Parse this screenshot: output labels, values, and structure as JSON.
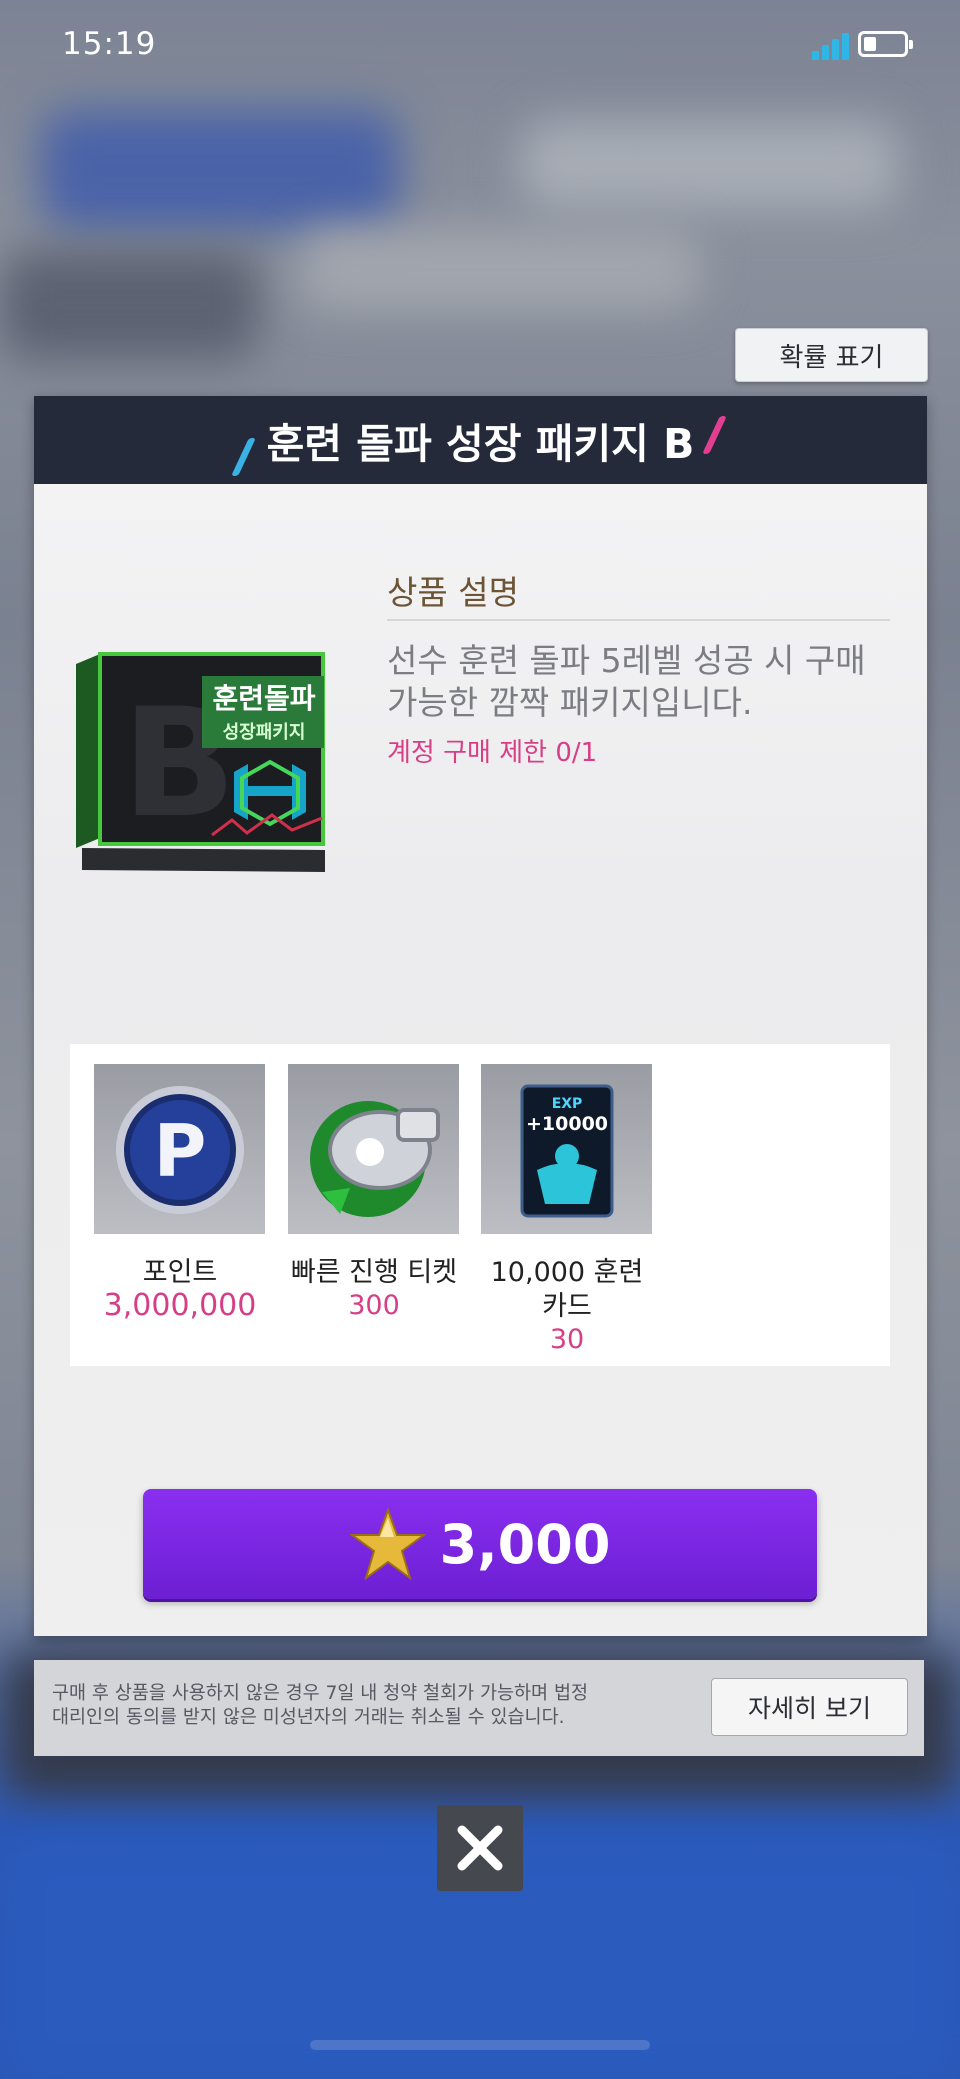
{
  "status_bar": {
    "time": "15:19",
    "battery_level": 0.3,
    "signal_bars": 4
  },
  "probability_button": {
    "label": "확률 표기"
  },
  "panel": {
    "title": "훈련 돌파 성장 패키지 B"
  },
  "package_image": {
    "icon": "training-breakthrough-package-box",
    "letter": "B",
    "label_line1": "훈련돌파",
    "label_line2": "성장패키지"
  },
  "description": {
    "heading": "상품 설명",
    "text": "선수 훈련 돌파 5레벨 성공 시 구매\n가능한 깜짝 패키지입니다.",
    "limit": "계정 구매 제한 0/1"
  },
  "rewards": [
    {
      "name": "포인트",
      "quantity": "3,000,000",
      "icon": "point-coin-icon"
    },
    {
      "name": "빠른 진행 티켓",
      "quantity": "300",
      "icon": "fast-progress-whistle-icon"
    },
    {
      "name": "10,000 훈련\n카드",
      "quantity": "30",
      "icon": "training-card-icon",
      "card_label1": "EXP",
      "card_label2": "+10000"
    }
  ],
  "buy_button": {
    "price": "3,000",
    "icon": "gold-star-icon"
  },
  "notice": {
    "text": "구매 후 상품을 사용하지 않은 경우 7일 내 청약 철회가 가능하며 법정\n대리인의 동의를 받지 않은 미성년자의 거래는 취소될 수 있습니다.",
    "detail_label": "자세히 보기"
  },
  "close_button": {
    "icon": "close-icon"
  },
  "colors": {
    "header": "#252a3a",
    "accent_pink": "#d63f86",
    "buy_purple": "#7a27e3",
    "accent_blue": "#39b2e6"
  }
}
